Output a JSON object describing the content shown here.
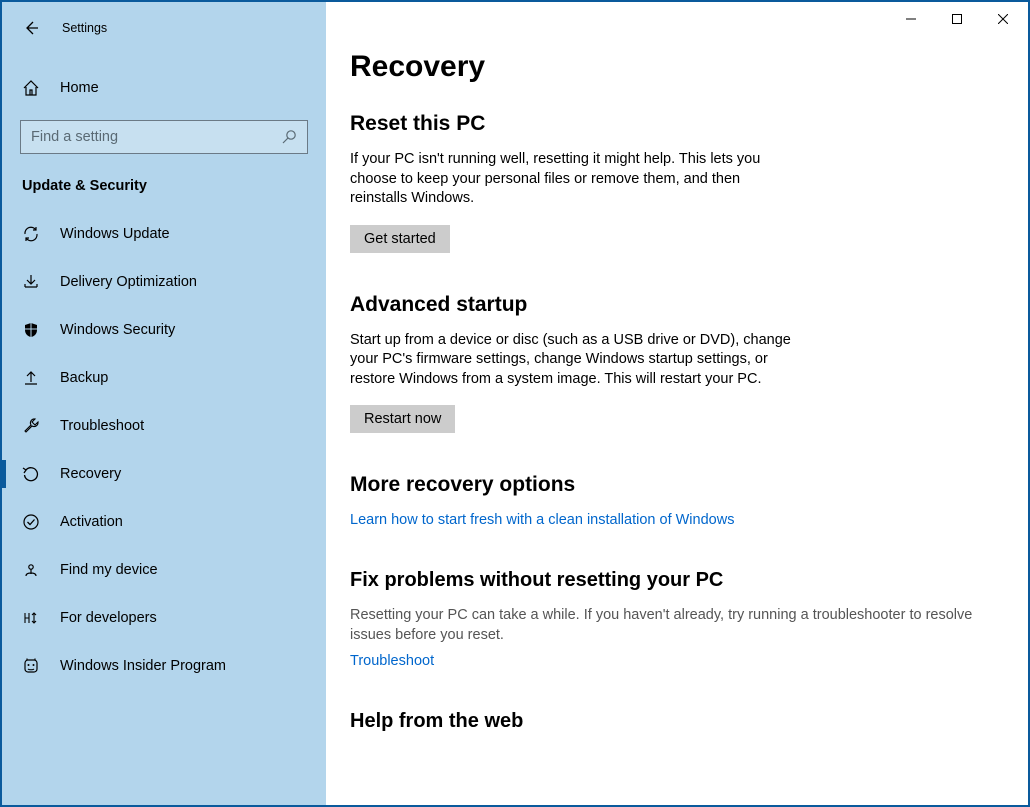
{
  "window": {
    "title": "Settings"
  },
  "sidebar": {
    "home": "Home",
    "search_placeholder": "Find a setting",
    "category": "Update & Security",
    "items": [
      {
        "label": "Windows Update"
      },
      {
        "label": "Delivery Optimization"
      },
      {
        "label": "Windows Security"
      },
      {
        "label": "Backup"
      },
      {
        "label": "Troubleshoot"
      },
      {
        "label": "Recovery"
      },
      {
        "label": "Activation"
      },
      {
        "label": "Find my device"
      },
      {
        "label": "For developers"
      },
      {
        "label": "Windows Insider Program"
      }
    ]
  },
  "main": {
    "title": "Recovery",
    "reset": {
      "heading": "Reset this PC",
      "desc": "If your PC isn't running well, resetting it might help. This lets you choose to keep your personal files or remove them, and then reinstalls Windows.",
      "button": "Get started"
    },
    "advanced": {
      "heading": "Advanced startup",
      "desc": "Start up from a device or disc (such as a USB drive or DVD), change your PC's firmware settings, change Windows startup settings, or restore Windows from a system image. This will restart your PC.",
      "button": "Restart now"
    },
    "more": {
      "heading": "More recovery options",
      "link": "Learn how to start fresh with a clean installation of Windows"
    },
    "fix": {
      "heading": "Fix problems without resetting your PC",
      "desc": "Resetting your PC can take a while. If you haven't already, try running a troubleshooter to resolve issues before you reset.",
      "link": "Troubleshoot"
    },
    "help": {
      "heading": "Help from the web"
    }
  }
}
